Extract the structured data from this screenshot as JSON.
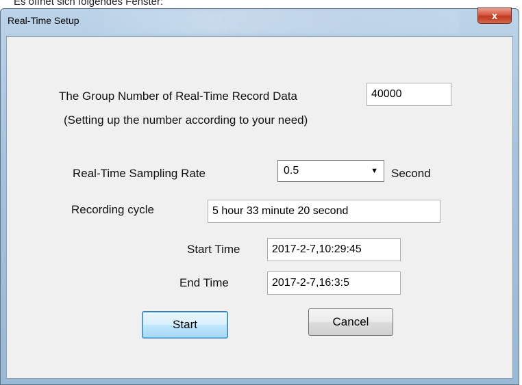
{
  "caption_above": "Es öffnet sich folgendes Fenster:",
  "window": {
    "title": "Real-Time Setup",
    "close_glyph": "x"
  },
  "group_number": {
    "label": "The Group Number of Real-Time Record Data",
    "value": "40000",
    "hint": "(Setting up the number according to your need)"
  },
  "sampling": {
    "label": "Real-Time Sampling Rate",
    "selected": "0.5",
    "arrow": "▼",
    "unit": "Second"
  },
  "recording": {
    "label": "Recording cycle",
    "value": "5 hour 33 minute 20 second"
  },
  "start_time": {
    "label": "Start Time",
    "value": "2017-2-7,10:29:45"
  },
  "end_time": {
    "label": "End Time",
    "value": "2017-2-7,16:3:5"
  },
  "buttons": {
    "start": "Start",
    "cancel": "Cancel"
  }
}
